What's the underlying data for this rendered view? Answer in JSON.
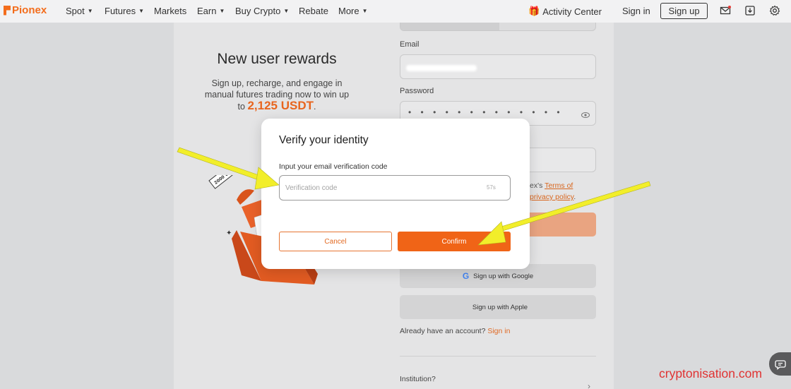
{
  "nav": {
    "logo": "Pionex",
    "items": [
      {
        "label": "Spot",
        "dropdown": true
      },
      {
        "label": "Futures",
        "dropdown": true
      },
      {
        "label": "Markets",
        "dropdown": false
      },
      {
        "label": "Earn",
        "dropdown": true
      },
      {
        "label": "Buy Crypto",
        "dropdown": true
      },
      {
        "label": "Rebate",
        "dropdown": false
      },
      {
        "label": "More",
        "dropdown": true
      }
    ],
    "activity_center": "Activity Center",
    "sign_in": "Sign in",
    "sign_up": "Sign up",
    "icons": [
      "mail-icon",
      "download-icon",
      "settings-icon"
    ]
  },
  "promo": {
    "title": "New user rewards",
    "text": "Sign up, recharge, and engage in manual futures trading now to win up",
    "to": "to",
    "amount": "2,125 USDT",
    "suffix": ".",
    "ticket": "2000 USDT"
  },
  "form": {
    "email_label": "Email",
    "password_label": "Password",
    "password_mask": "• • • • • • • • • • • • •",
    "terms_prefix": "ex's",
    "terms_link": "Terms of",
    "privacy_link": "privacy policy",
    "google_button": "Sign up with Google",
    "apple_button": "Sign up with Apple",
    "already_text": "Already have an account?",
    "sign_in_link": "Sign in",
    "institution": "Institution?"
  },
  "modal": {
    "title": "Verify your identity",
    "label": "Input your email verification code",
    "placeholder": "Verification code",
    "timer": "57s",
    "cancel": "Cancel",
    "confirm": "Confirm"
  },
  "watermark": "cryptonisation.com",
  "colors": {
    "brand": "#f36d1c",
    "confirm": "#f06417",
    "arrow": "#f2ee2a"
  }
}
